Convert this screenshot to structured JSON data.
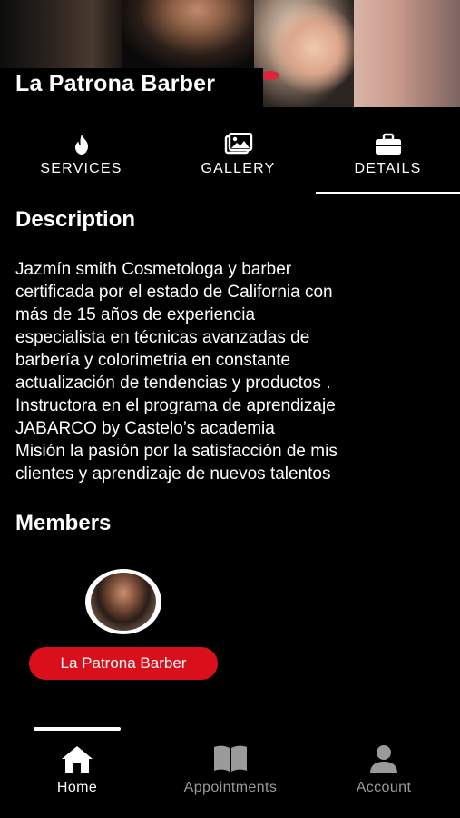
{
  "header": {
    "title": "La Patrona Barber"
  },
  "tabs": [
    {
      "label": "SERVICES",
      "icon": "flame-icon"
    },
    {
      "label": "GALLERY",
      "icon": "image-icon"
    },
    {
      "label": "DETAILS",
      "icon": "briefcase-icon",
      "active": true
    }
  ],
  "description": {
    "heading": "Description",
    "text": "Jazmín smith Cosmetologa y barber\ncertificada por el estado de California con\nmás de 15 años de experiencia\nespecialista en técnicas avanzadas de\nbarbería y colorimetria en constante\nactualización de tendencias y productos .\nInstructora en el programa de aprendizaje\nJABARCO by Castelo’s academia\n Misión la pasión por la satisfacción de mis\nclientes y aprendizaje de nuevos talentos"
  },
  "members": {
    "heading": "Members",
    "items": [
      {
        "name": "La Patrona Barber"
      }
    ]
  },
  "bottom_nav": [
    {
      "label": "Home",
      "icon": "home-icon",
      "active": true
    },
    {
      "label": "Appointments",
      "icon": "book-icon"
    },
    {
      "label": "Account",
      "icon": "person-icon"
    }
  ],
  "colors": {
    "background": "#000000",
    "accent": "#d9101c",
    "inactive_nav": "#9a9a9a"
  }
}
